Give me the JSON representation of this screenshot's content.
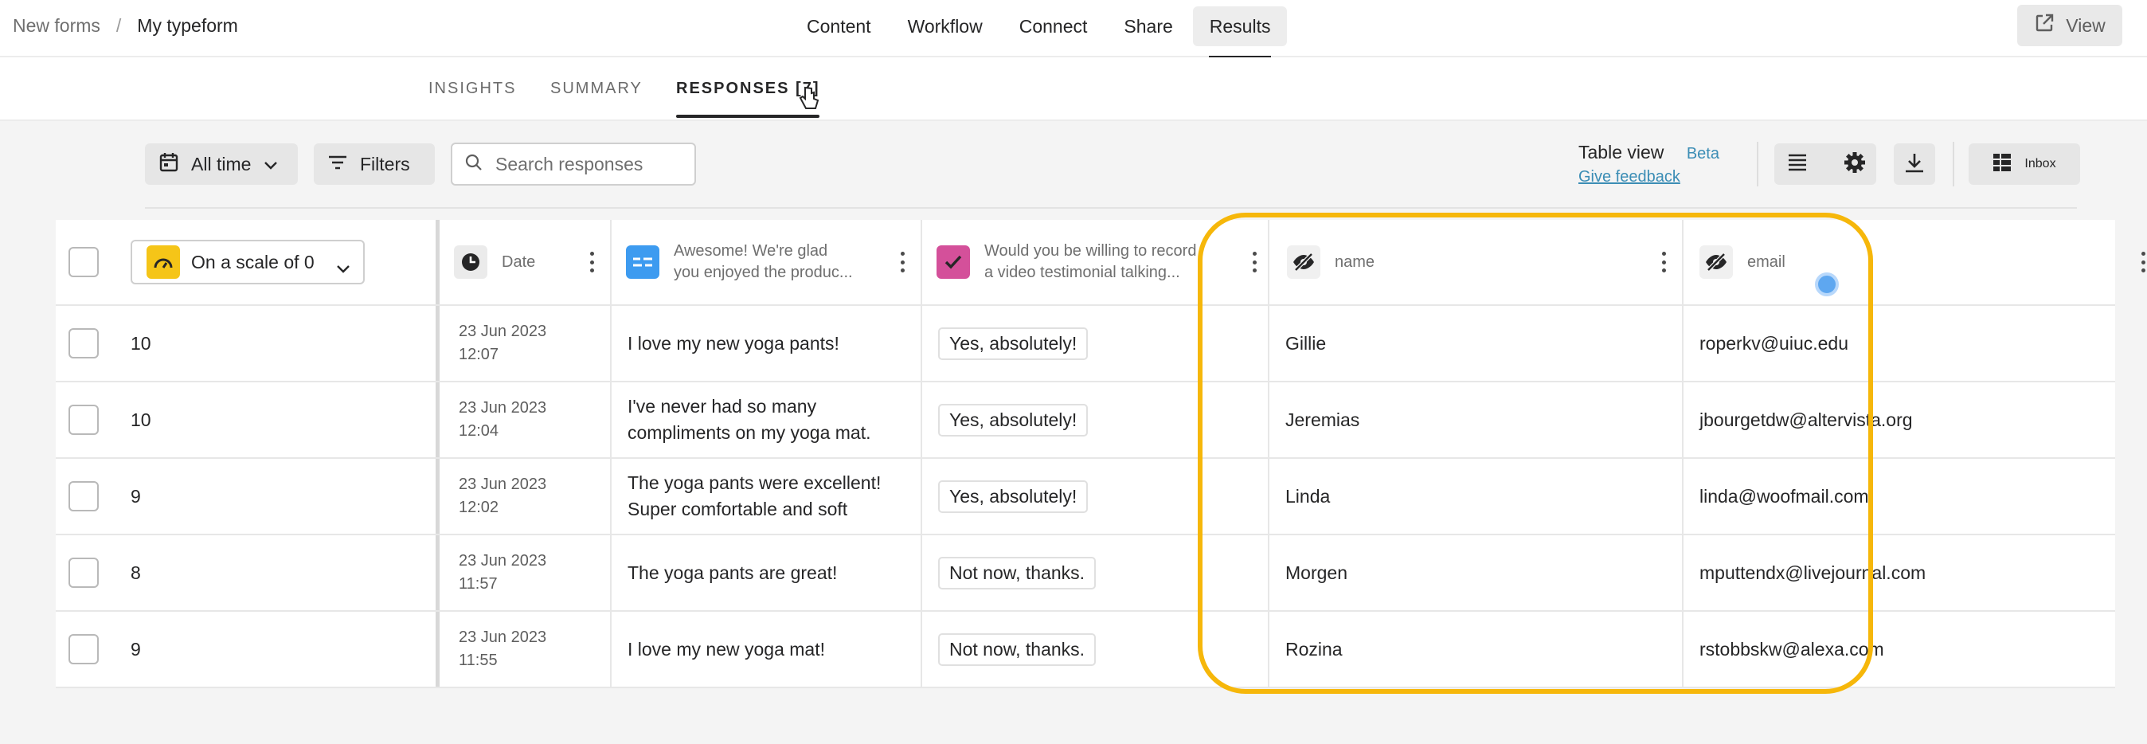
{
  "breadcrumb": {
    "parent": "New forms",
    "separator": "/",
    "current": "My typeform"
  },
  "top_nav": {
    "items": [
      {
        "label": "Content"
      },
      {
        "label": "Workflow"
      },
      {
        "label": "Connect"
      },
      {
        "label": "Share"
      },
      {
        "label": "Results"
      }
    ],
    "active": "Results"
  },
  "view_button": {
    "label": "View"
  },
  "sub_tabs": {
    "items": [
      {
        "label": "INSIGHTS"
      },
      {
        "label": "SUMMARY"
      },
      {
        "label": "RESPONSES [7]"
      }
    ],
    "active": "RESPONSES [7]"
  },
  "toolbar": {
    "date_filter": "All time",
    "filters": "Filters",
    "search_placeholder": "Search responses",
    "table_view": "Table view",
    "beta": "Beta",
    "feedback": "Give feedback",
    "inbox": "Inbox"
  },
  "table": {
    "scale_column": "On a scale of 0",
    "columns": [
      {
        "label": "Date",
        "icon": "clock-icon",
        "color": "#262627"
      },
      {
        "label1": "Awesome! We're glad",
        "label2": "you enjoyed the produc...",
        "icon": "text-icon",
        "color": "#3d9bf0"
      },
      {
        "label1": "Would you be willing to record",
        "label2": "a video testimonial talking...",
        "icon": "checkmark-icon",
        "color": "#d4509a"
      },
      {
        "label": "name",
        "icon": "hidden-eye-icon",
        "color": "#f0f0f0"
      },
      {
        "label": "email",
        "icon": "hidden-eye-icon",
        "color": "#f0f0f0"
      }
    ],
    "rows": [
      {
        "score": "10",
        "date": "23 Jun 2023",
        "time": "12:07",
        "feedback1": "I love my new yoga pants!",
        "feedback2": "",
        "video": "Yes, absolutely!",
        "name": "Gillie",
        "email": "roperkv@uiuc.edu"
      },
      {
        "score": "10",
        "date": "23 Jun 2023",
        "time": "12:04",
        "feedback1": "I've never had so many",
        "feedback2": "compliments on my yoga mat.",
        "video": "Yes, absolutely!",
        "name": "Jeremias",
        "email": "jbourgetdw@altervista.org"
      },
      {
        "score": "9",
        "date": "23 Jun 2023",
        "time": "12:02",
        "feedback1": "The yoga pants were excellent!",
        "feedback2": "Super comfortable and soft",
        "video": "Yes, absolutely!",
        "name": "Linda",
        "email": "linda@woofmail.com"
      },
      {
        "score": "8",
        "date": "23 Jun 2023",
        "time": "11:57",
        "feedback1": "The yoga pants are great!",
        "feedback2": "",
        "video": "Not now, thanks.",
        "name": "Morgen",
        "email": "mputtendx@livejournal.com"
      },
      {
        "score": "9",
        "date": "23 Jun 2023",
        "time": "11:55",
        "feedback1": "I love my new yoga mat!",
        "feedback2": "",
        "video": "Not now, thanks.",
        "name": "Rozina",
        "email": "rstobbskw@alexa.com"
      }
    ]
  },
  "colors": {
    "highlight": "#f6b70a",
    "scale_icon": "#f5c518",
    "link": "#3b8db5"
  }
}
